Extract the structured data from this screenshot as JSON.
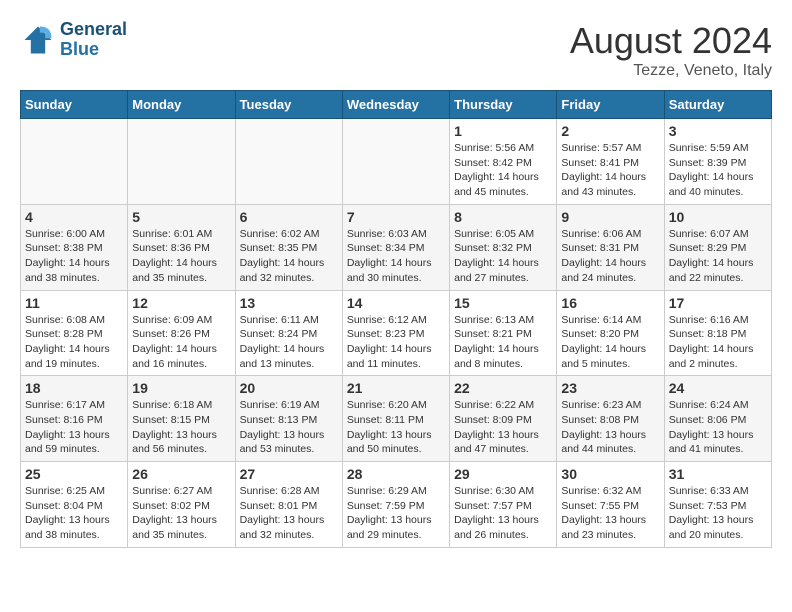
{
  "header": {
    "logo_line1": "General",
    "logo_line2": "Blue",
    "month": "August 2024",
    "location": "Tezze, Veneto, Italy"
  },
  "weekdays": [
    "Sunday",
    "Monday",
    "Tuesday",
    "Wednesday",
    "Thursday",
    "Friday",
    "Saturday"
  ],
  "weeks": [
    [
      {
        "day": "",
        "info": ""
      },
      {
        "day": "",
        "info": ""
      },
      {
        "day": "",
        "info": ""
      },
      {
        "day": "",
        "info": ""
      },
      {
        "day": "1",
        "info": "Sunrise: 5:56 AM\nSunset: 8:42 PM\nDaylight: 14 hours and 45 minutes."
      },
      {
        "day": "2",
        "info": "Sunrise: 5:57 AM\nSunset: 8:41 PM\nDaylight: 14 hours and 43 minutes."
      },
      {
        "day": "3",
        "info": "Sunrise: 5:59 AM\nSunset: 8:39 PM\nDaylight: 14 hours and 40 minutes."
      }
    ],
    [
      {
        "day": "4",
        "info": "Sunrise: 6:00 AM\nSunset: 8:38 PM\nDaylight: 14 hours and 38 minutes."
      },
      {
        "day": "5",
        "info": "Sunrise: 6:01 AM\nSunset: 8:36 PM\nDaylight: 14 hours and 35 minutes."
      },
      {
        "day": "6",
        "info": "Sunrise: 6:02 AM\nSunset: 8:35 PM\nDaylight: 14 hours and 32 minutes."
      },
      {
        "day": "7",
        "info": "Sunrise: 6:03 AM\nSunset: 8:34 PM\nDaylight: 14 hours and 30 minutes."
      },
      {
        "day": "8",
        "info": "Sunrise: 6:05 AM\nSunset: 8:32 PM\nDaylight: 14 hours and 27 minutes."
      },
      {
        "day": "9",
        "info": "Sunrise: 6:06 AM\nSunset: 8:31 PM\nDaylight: 14 hours and 24 minutes."
      },
      {
        "day": "10",
        "info": "Sunrise: 6:07 AM\nSunset: 8:29 PM\nDaylight: 14 hours and 22 minutes."
      }
    ],
    [
      {
        "day": "11",
        "info": "Sunrise: 6:08 AM\nSunset: 8:28 PM\nDaylight: 14 hours and 19 minutes."
      },
      {
        "day": "12",
        "info": "Sunrise: 6:09 AM\nSunset: 8:26 PM\nDaylight: 14 hours and 16 minutes."
      },
      {
        "day": "13",
        "info": "Sunrise: 6:11 AM\nSunset: 8:24 PM\nDaylight: 14 hours and 13 minutes."
      },
      {
        "day": "14",
        "info": "Sunrise: 6:12 AM\nSunset: 8:23 PM\nDaylight: 14 hours and 11 minutes."
      },
      {
        "day": "15",
        "info": "Sunrise: 6:13 AM\nSunset: 8:21 PM\nDaylight: 14 hours and 8 minutes."
      },
      {
        "day": "16",
        "info": "Sunrise: 6:14 AM\nSunset: 8:20 PM\nDaylight: 14 hours and 5 minutes."
      },
      {
        "day": "17",
        "info": "Sunrise: 6:16 AM\nSunset: 8:18 PM\nDaylight: 14 hours and 2 minutes."
      }
    ],
    [
      {
        "day": "18",
        "info": "Sunrise: 6:17 AM\nSunset: 8:16 PM\nDaylight: 13 hours and 59 minutes."
      },
      {
        "day": "19",
        "info": "Sunrise: 6:18 AM\nSunset: 8:15 PM\nDaylight: 13 hours and 56 minutes."
      },
      {
        "day": "20",
        "info": "Sunrise: 6:19 AM\nSunset: 8:13 PM\nDaylight: 13 hours and 53 minutes."
      },
      {
        "day": "21",
        "info": "Sunrise: 6:20 AM\nSunset: 8:11 PM\nDaylight: 13 hours and 50 minutes."
      },
      {
        "day": "22",
        "info": "Sunrise: 6:22 AM\nSunset: 8:09 PM\nDaylight: 13 hours and 47 minutes."
      },
      {
        "day": "23",
        "info": "Sunrise: 6:23 AM\nSunset: 8:08 PM\nDaylight: 13 hours and 44 minutes."
      },
      {
        "day": "24",
        "info": "Sunrise: 6:24 AM\nSunset: 8:06 PM\nDaylight: 13 hours and 41 minutes."
      }
    ],
    [
      {
        "day": "25",
        "info": "Sunrise: 6:25 AM\nSunset: 8:04 PM\nDaylight: 13 hours and 38 minutes."
      },
      {
        "day": "26",
        "info": "Sunrise: 6:27 AM\nSunset: 8:02 PM\nDaylight: 13 hours and 35 minutes."
      },
      {
        "day": "27",
        "info": "Sunrise: 6:28 AM\nSunset: 8:01 PM\nDaylight: 13 hours and 32 minutes."
      },
      {
        "day": "28",
        "info": "Sunrise: 6:29 AM\nSunset: 7:59 PM\nDaylight: 13 hours and 29 minutes."
      },
      {
        "day": "29",
        "info": "Sunrise: 6:30 AM\nSunset: 7:57 PM\nDaylight: 13 hours and 26 minutes."
      },
      {
        "day": "30",
        "info": "Sunrise: 6:32 AM\nSunset: 7:55 PM\nDaylight: 13 hours and 23 minutes."
      },
      {
        "day": "31",
        "info": "Sunrise: 6:33 AM\nSunset: 7:53 PM\nDaylight: 13 hours and 20 minutes."
      }
    ]
  ]
}
